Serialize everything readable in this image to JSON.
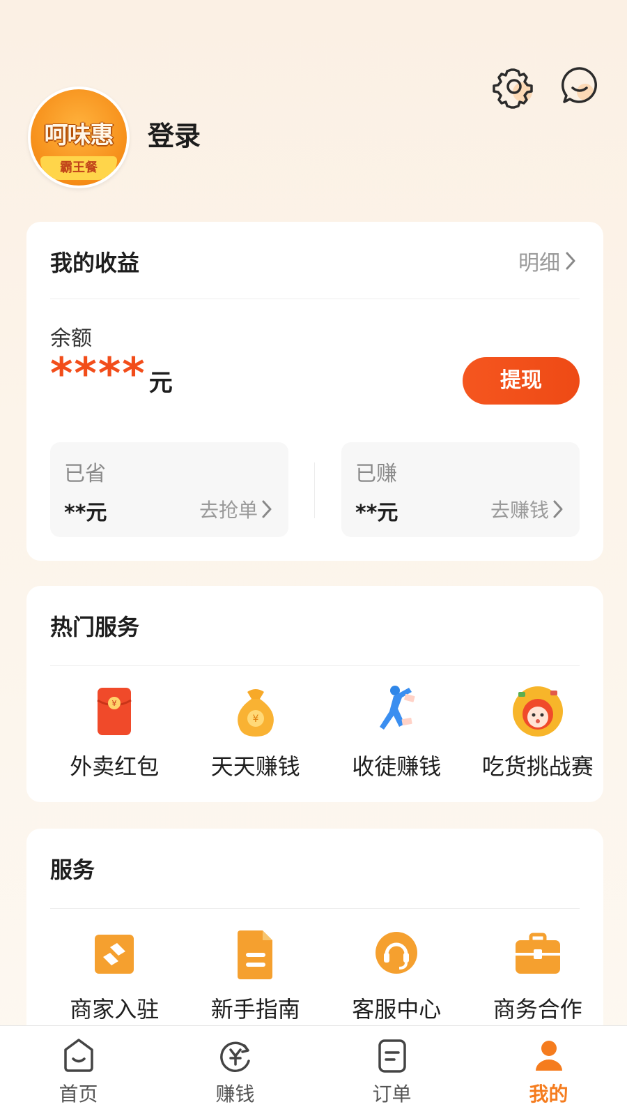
{
  "header": {
    "avatar_brand": "呵味惠",
    "avatar_ribbon": "霸王餐",
    "login_label": "登录",
    "icons": [
      "settings-icon",
      "message-icon"
    ]
  },
  "earnings": {
    "title": "我的收益",
    "detail_label": "明细",
    "balance_label": "余额",
    "balance_masked": "****",
    "currency": "元",
    "withdraw_label": "提现",
    "saved": {
      "title": "已省",
      "value": "**元",
      "link": "去抢单"
    },
    "earned": {
      "title": "已赚",
      "value": "**元",
      "link": "去赚钱"
    }
  },
  "hot_services": {
    "title": "热门服务",
    "items": [
      {
        "label": "外卖红包",
        "icon": "red-envelope-icon"
      },
      {
        "label": "天天赚钱",
        "icon": "money-bag-icon"
      },
      {
        "label": "收徒赚钱",
        "icon": "recruit-person-icon"
      },
      {
        "label": "吃货挑战赛",
        "icon": "foodie-mascot-icon"
      }
    ]
  },
  "services": {
    "title": "服务",
    "items": [
      {
        "label": "商家入驻",
        "icon": "merchant-icon"
      },
      {
        "label": "新手指南",
        "icon": "guide-document-icon"
      },
      {
        "label": "客服中心",
        "icon": "customer-service-icon"
      },
      {
        "label": "商务合作",
        "icon": "briefcase-icon"
      }
    ]
  },
  "tabbar": {
    "items": [
      {
        "label": "首页",
        "icon": "home-icon",
        "active": false
      },
      {
        "label": "赚钱",
        "icon": "earn-money-icon",
        "active": false
      },
      {
        "label": "订单",
        "icon": "order-icon",
        "active": false
      },
      {
        "label": "我的",
        "icon": "profile-icon",
        "active": true
      }
    ]
  },
  "colors": {
    "accent": "#f24d1a",
    "icon_orange": "#f5a623",
    "tab_active": "#f57c1e"
  }
}
